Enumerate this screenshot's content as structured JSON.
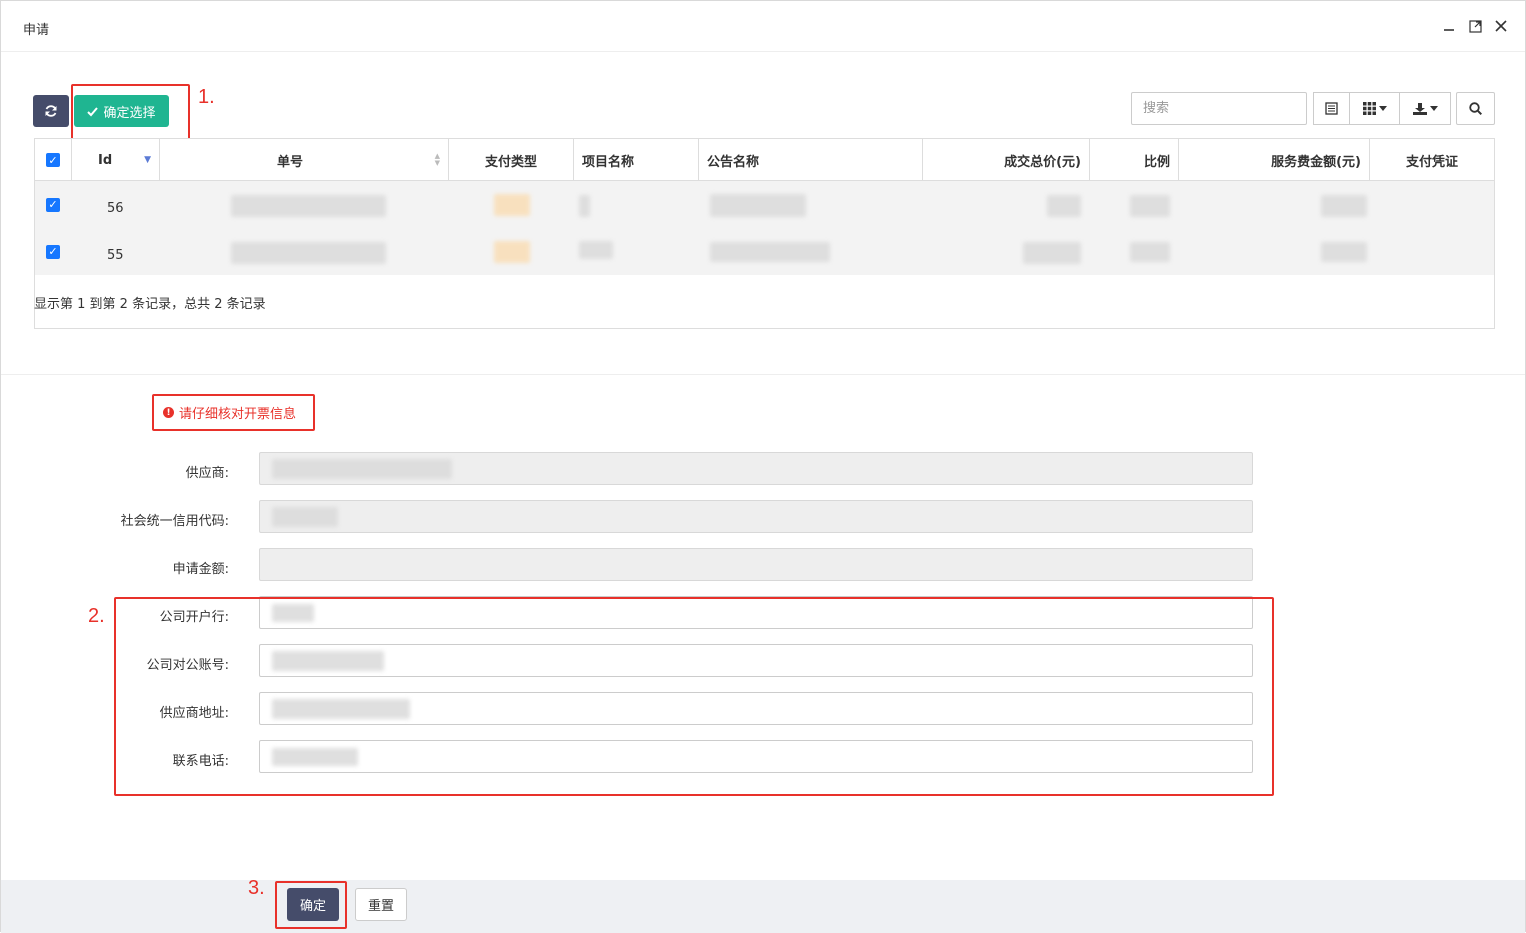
{
  "window": {
    "title": "申请"
  },
  "annotations": {
    "step1": "1.",
    "step2": "2.",
    "step3": "3."
  },
  "toolbar": {
    "confirm_select_label": "确定选择",
    "search_placeholder": "搜索"
  },
  "table": {
    "columns": [
      "Id",
      "单号",
      "支付类型",
      "项目名称",
      "公告名称",
      "成交总价(元)",
      "比例",
      "服务费金额(元)",
      "支付凭证"
    ],
    "rows": [
      {
        "id": "56",
        "checked": true
      },
      {
        "id": "55",
        "checked": true
      }
    ],
    "info": "显示第 1 到第 2 条记录，总共 2 条记录"
  },
  "form": {
    "notice": "请仔细核对开票信息",
    "fields": [
      {
        "label": "供应商:",
        "readonly": true
      },
      {
        "label": "社会统一信用代码:",
        "readonly": true
      },
      {
        "label": "申请金额:",
        "readonly": true
      },
      {
        "label": "公司开户行:",
        "readonly": false
      },
      {
        "label": "公司对公账号:",
        "readonly": false
      },
      {
        "label": "供应商地址:",
        "readonly": false
      },
      {
        "label": "联系电话:",
        "readonly": false
      }
    ]
  },
  "footer": {
    "confirm_label": "确定",
    "reset_label": "重置"
  },
  "colors": {
    "accent_dark": "#454c6a",
    "success": "#1fb591",
    "annotation": "#e8312a",
    "checkbox": "#1677ff"
  }
}
